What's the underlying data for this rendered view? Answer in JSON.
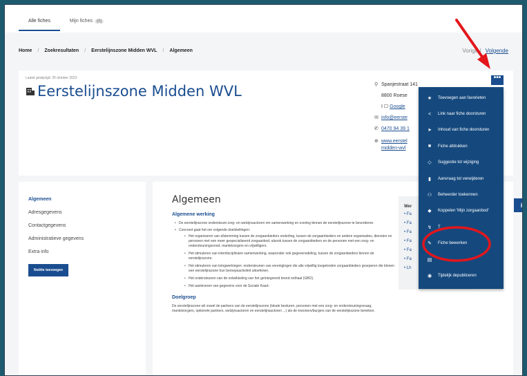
{
  "tabs": [
    {
      "label": "Alle fiches"
    },
    {
      "label": "Mijn fiches",
      "count": "(0)"
    }
  ],
  "breadcrumb": [
    "Home",
    "Zoekresultaten",
    "Eerstelijnszone Midden WVL",
    "Algemeen"
  ],
  "pager": {
    "prev": "Vorige",
    "next": "Volgende"
  },
  "header": {
    "updated": "Laatst gewijzigd: 25 oktober 2023",
    "title": "Eerstelijnszone Midden WVL"
  },
  "contact": {
    "address_line1": "Spanjestraat 141",
    "address_line2": "8800 Roese",
    "maps_link": "Google",
    "email": "info@eerste",
    "phone": "0470 94 39 1",
    "website_line1": "www.eerstel",
    "website_line2": "midden-wvl"
  },
  "menu": {
    "more_label": "•••",
    "items": [
      {
        "icon": "★",
        "icon_name": "star-icon",
        "label": "Toevoegen aan favorieten"
      },
      {
        "icon": "<",
        "icon_name": "share-icon",
        "label": "Link naar fiche doorsturen"
      },
      {
        "icon": "➤",
        "icon_name": "send-icon",
        "label": "Inhoud van fiche doorsturen"
      },
      {
        "icon": "■",
        "icon_name": "print-icon",
        "label": "Fiche afdrukken"
      },
      {
        "icon": "◇",
        "icon_name": "suggestion-icon",
        "label": "Suggestie tot wijziging"
      },
      {
        "icon": "▮",
        "icon_name": "trash-icon",
        "label": "Aanvraag tot verwijderen"
      },
      {
        "icon": "⚇",
        "icon_name": "users-icon",
        "label": "Beheerder toekennen"
      },
      {
        "icon": "◆",
        "icon_name": "tag-icon",
        "label": "Koppelen 'Mijn zorgaanbod'"
      },
      {
        "icon": "↯",
        "icon_name": "link-icon",
        "label": "T"
      },
      {
        "icon": "✎",
        "icon_name": "pencil-icon",
        "label": "Fiche bewerken"
      },
      {
        "icon": "▤",
        "icon_name": "copy-icon",
        "label": ""
      },
      {
        "icon": "◉",
        "icon_name": "eye-off-icon",
        "label": "Tijdelijk depubliceren"
      }
    ]
  },
  "sidebar": {
    "items": [
      "Algemeen",
      "Adresgegevens",
      "Contactgegevens",
      "Administratieve gegevens",
      "Extra info"
    ],
    "button": "Notitie toevoegen"
  },
  "main": {
    "title": "Algemeen",
    "section1": "Algemene werking",
    "bullet1": "De eerstelijnszone ondersteunt zorg- en welzijnsactoren om samenwerking en overleg binnen de eerstelijnszone te bevorderen.",
    "bullet2": "Concreet gaat het om volgende doelstellingen:",
    "sub_bullets": [
      "Het organiseren van afstemming tussen de zorgaanbieders onderling, tussen de zorgaanbieders en andere organisaties, diensten en personen met een meer gespecialiseerd zorgaanbod, alsook tussen de zorgaanbieders en de personen met een zorg- en ondersteuningsnood, mantelzorgers en vrijwilligers.",
      "Het stimuleren van interdisciplinaire samenwerking, waaronder ook gegevensdeling, tussen de zorgaanbieders binnen de eerstelijnszone.",
      "Het stimuleren van kringwerkingen: ondersteunen van verenigingen die alle vrijwillig toegetreden zorgaanbieders groeperen die binnen een eerstelijnszone hun beroepsactiviteit uitoefenen.",
      "Het ondersteunen van de ontwikkeling van het geïntegreerd breed onthaal (GBO).",
      "Het aanleveren van gegevens voor de Sociale Kaart."
    ],
    "section2": "Doelgroep",
    "doelgroep": "De eerstelijnszone wil zowel de partners van de eerstelijnszone (lokale besturen, personen met een zorg- en ondersteuningsvraag, mantelzorgers, optionele partners, welzijnsactoren en eerstelijnsactoren ...) als de inwoners/burgers van de eerstelijnszone bereiken."
  },
  "right_panel": {
    "heading": "Wer",
    "items": [
      "Fa",
      "Fa",
      "Fa",
      "Fa",
      "Fa",
      "Fa",
      "Lh"
    ]
  },
  "info_tab": "i",
  "colors": {
    "brand": "#1a4d8f",
    "menu": "#15497e",
    "annotation": "#e3161b"
  }
}
